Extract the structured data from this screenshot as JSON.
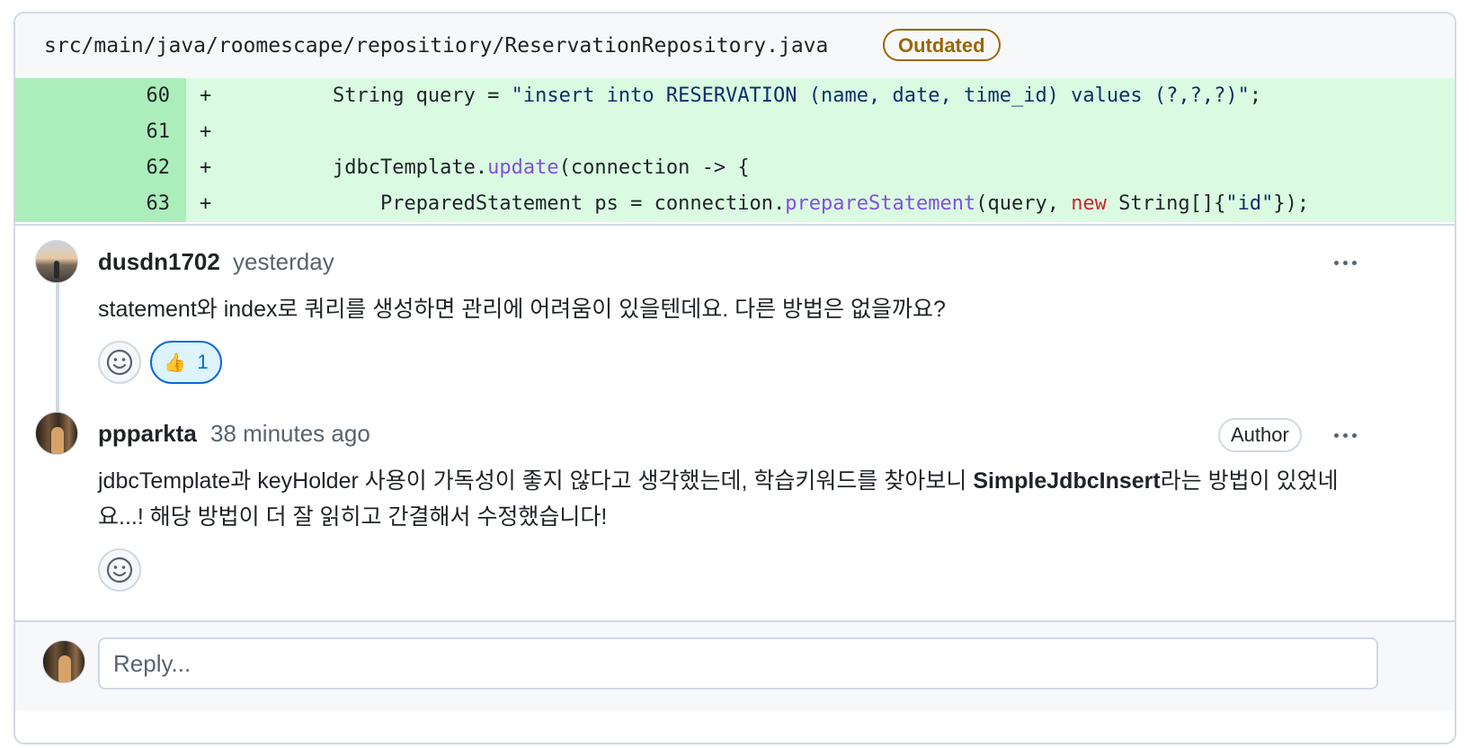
{
  "file": {
    "path": "src/main/java/roomescape/repositiory/ReservationRepository.java",
    "badge": "Outdated"
  },
  "diff": {
    "marker": "+",
    "lines": [
      {
        "number": "60",
        "indent": "        ",
        "parts": [
          {
            "text": "String query = ",
            "kind": "plain"
          },
          {
            "text": "\"insert into RESERVATION (name, date, time_id) values (?,?,?)\"",
            "kind": "string"
          },
          {
            "text": ";",
            "kind": "plain"
          }
        ]
      },
      {
        "number": "61",
        "indent": "",
        "parts": []
      },
      {
        "number": "62",
        "indent": "        ",
        "parts": [
          {
            "text": "jdbcTemplate.",
            "kind": "plain"
          },
          {
            "text": "update",
            "kind": "function"
          },
          {
            "text": "(connection -> {",
            "kind": "plain"
          }
        ]
      },
      {
        "number": "63",
        "indent": "            ",
        "parts": [
          {
            "text": "PreparedStatement ps = connection.",
            "kind": "plain"
          },
          {
            "text": "prepareStatement",
            "kind": "function"
          },
          {
            "text": "(query, ",
            "kind": "plain"
          },
          {
            "text": "new",
            "kind": "keyword"
          },
          {
            "text": " String[]{",
            "kind": "plain"
          },
          {
            "text": "\"id\"",
            "kind": "string"
          },
          {
            "text": "});",
            "kind": "plain"
          }
        ]
      }
    ]
  },
  "comments": [
    {
      "author": "dusdn1702",
      "time": "yesterday",
      "body": "statement와 index로 쿼리를 생성하면 관리에 어려움이 있을텐데요. 다른 방법은 없을까요?",
      "reaction": {
        "emoji": "👍",
        "count": "1"
      },
      "avatar_icon": "avatar-landscape"
    },
    {
      "author": "ppparkta",
      "time": "38 minutes ago",
      "badge": "Author",
      "body_before": "jdbcTemplate과 keyHolder 사용이 가독성이 좋지 않다고 생각했는데, 학습키워드를 찾아보니 ",
      "body_bold": "SimpleJdbcInsert",
      "body_after": "라는 방법이 있었네요...! 해당 방법이 더 잘 읽히고 간결해서 수정했습니다!",
      "avatar_icon": "avatar-person"
    }
  ],
  "reply": {
    "placeholder": "Reply..."
  },
  "colors": {
    "added_line": "#dafbe1",
    "added_gutter": "#aceebb",
    "outdated_badge": "#9a6700",
    "reaction_accent": "#0969da",
    "code_string": "#0a3069",
    "code_function": "#8250df",
    "code_keyword": "#cf222e"
  },
  "icons": {
    "more": "kebab-horizontal-icon",
    "emoji": "smiley-icon",
    "thumbs_up": "thumbs-up-icon"
  }
}
